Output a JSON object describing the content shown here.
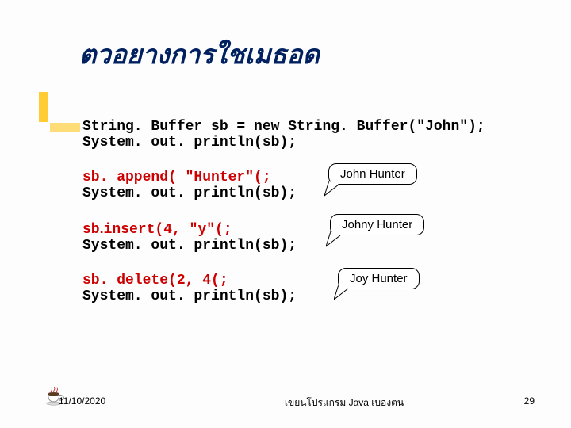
{
  "title": "ตวอยางการใชเมธอด",
  "code": {
    "line1": "String. Buffer sb = new String. Buffer(\"John\");",
    "line2": "System. out. println(sb);",
    "block2_call": "sb. append( \"Hunter\"(;",
    "block2_print": "System. out. println(sb);",
    "block3_call_pre": "sb",
    "block3_call_dot": ".",
    "block3_call_post": "insert(4, \"y\"(;",
    "block3_print": "System. out. println(sb);",
    "block4_call": "sb. delete(2, 4(;",
    "block4_print": "System. out. println(sb);"
  },
  "callouts": {
    "c1": "John  Hunter",
    "c2": "Johny  Hunter",
    "c3": "Joy  Hunter"
  },
  "footer": {
    "date": "11/10/2020",
    "center": "เขยนโปรแกรม   Java เบองตน",
    "page": "29"
  }
}
